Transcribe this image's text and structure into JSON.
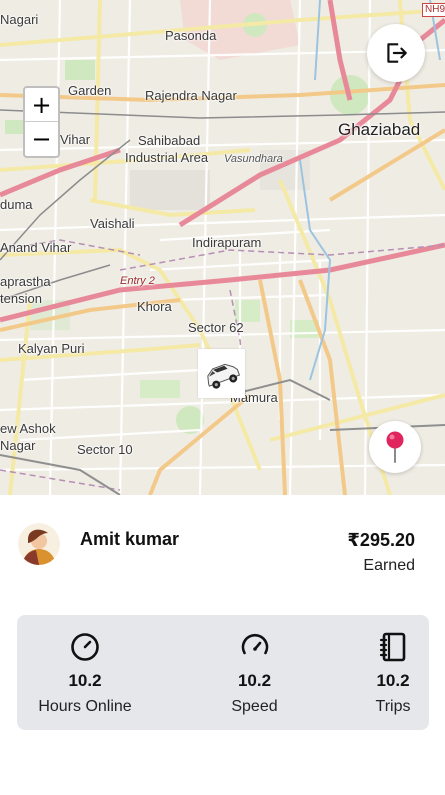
{
  "map": {
    "labels": {
      "nagari": "Nagari",
      "pasonda": "Pasonda",
      "garden": "Garden",
      "rajendra": "Rajendra Nagar",
      "ghaziabad": "Ghaziabad",
      "vihar": "Vihar",
      "sahibabad": "Sahibabad",
      "industrial": "Industrial Area",
      "vasundhara": "Vasundhara",
      "duma": "duma",
      "vaishali": "Vaishali",
      "indirapuram": "Indirapuram",
      "anand": "Anand Vihar",
      "aprastha": "aprastha",
      "tension": "tension",
      "entry2": "Entry 2",
      "khora": "Khora",
      "sector62": "Sector 62",
      "kalyan": "Kalyan Puri",
      "mamura": "Mamura",
      "ashok": "ew Ashok",
      "nagar": "Nagar",
      "sector10": "Sector 10",
      "nh": "NH9"
    },
    "zoom_in": "+",
    "zoom_out": "−"
  },
  "driver": {
    "name": "Amit kumar",
    "earned_amount": "₹295.20",
    "earned_label": "Earned"
  },
  "stats": [
    {
      "value": "10.2",
      "label": "Hours Online",
      "icon": "timer-icon"
    },
    {
      "value": "10.2",
      "label": "Speed",
      "icon": "speedometer-icon"
    },
    {
      "value": "10.2",
      "label": "Trips",
      "icon": "notebook-icon"
    }
  ],
  "colors": {
    "stats_bg": "#e6e7eb",
    "pin": "#e0245e"
  }
}
